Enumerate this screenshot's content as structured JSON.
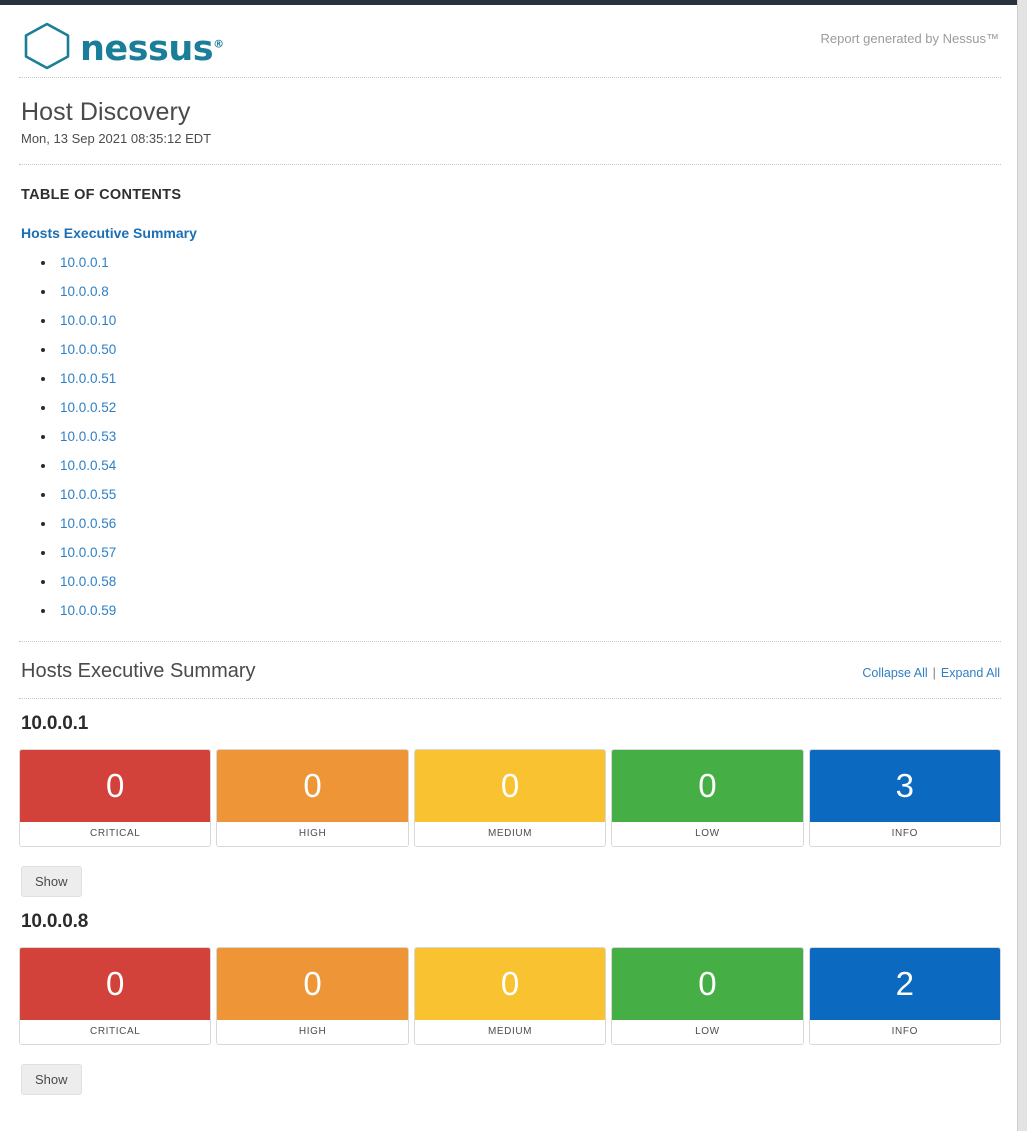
{
  "header": {
    "logo_word": "nessus",
    "logo_tm": "®",
    "logo_icon": "hexagon-icon",
    "generated_by": "Report generated by Nessus™"
  },
  "report": {
    "title": "Host Discovery",
    "date": "Mon, 13 Sep 2021 08:35:12 EDT"
  },
  "toc": {
    "heading": "TABLE OF CONTENTS",
    "section_link": "Hosts Executive Summary",
    "items": [
      {
        "label": "10.0.0.1"
      },
      {
        "label": "10.0.0.8"
      },
      {
        "label": "10.0.0.10"
      },
      {
        "label": "10.0.0.50"
      },
      {
        "label": "10.0.0.51"
      },
      {
        "label": "10.0.0.52"
      },
      {
        "label": "10.0.0.53"
      },
      {
        "label": "10.0.0.54"
      },
      {
        "label": "10.0.0.55"
      },
      {
        "label": "10.0.0.56"
      },
      {
        "label": "10.0.0.57"
      },
      {
        "label": "10.0.0.58"
      },
      {
        "label": "10.0.0.59"
      }
    ]
  },
  "summary": {
    "title": "Hosts Executive Summary",
    "collapse_all": "Collapse All",
    "separator": "|",
    "expand_all": "Expand All",
    "show_button": "Show"
  },
  "severity_labels": {
    "critical": "CRITICAL",
    "high": "HIGH",
    "medium": "MEDIUM",
    "low": "LOW",
    "info": "INFO"
  },
  "colors": {
    "critical": "#d2413a",
    "high": "#ed9537",
    "medium": "#f9c231",
    "low": "#45ae45",
    "info": "#0b69bf",
    "brand_teal": "#1b7e99",
    "link_blue": "#2f7fc4",
    "topbar": "#28333d"
  },
  "hosts": [
    {
      "name": "10.0.0.1",
      "counts": {
        "critical": "0",
        "high": "0",
        "medium": "0",
        "low": "0",
        "info": "3"
      }
    },
    {
      "name": "10.0.0.8",
      "counts": {
        "critical": "0",
        "high": "0",
        "medium": "0",
        "low": "0",
        "info": "2"
      }
    }
  ]
}
